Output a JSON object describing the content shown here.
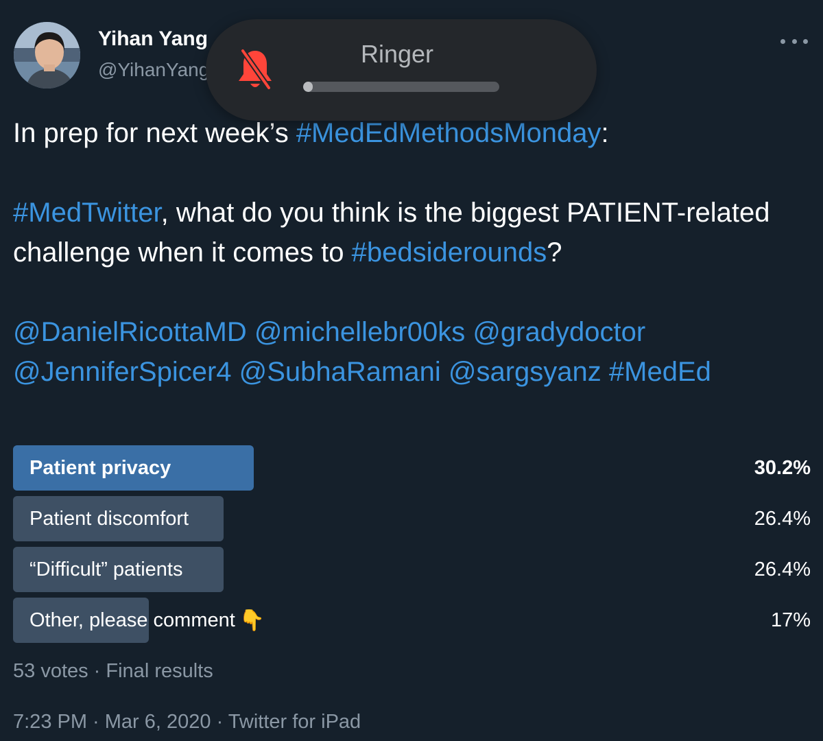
{
  "author": {
    "display_name": "Yihan Yang",
    "handle": "@YihanYang"
  },
  "overlay": {
    "label": "Ringer",
    "icon": "bell-muted-icon",
    "level": 0.05
  },
  "tweet": {
    "line1_pre": "In prep for next week’s ",
    "line1_tag": "#MedEdMethodsMonday",
    "line1_post": ":",
    "para2_tag1": "#MedTwitter",
    "para2_text": ", what do you think is the biggest PATIENT-related challenge when it comes to ",
    "para2_tag2": "#bedsiderounds",
    "para2_post": "?",
    "mentions": "@DanielRicottaMD @michellebr00ks @gradydoctor @JenniferSpicer4 @SubhaRamani @sargsyanz #MedEd"
  },
  "poll": {
    "options": [
      {
        "label": "Patient privacy",
        "percent_text": "30.2%",
        "fraction": 0.302,
        "winner": true
      },
      {
        "label": "Patient discomfort",
        "percent_text": "26.4%",
        "fraction": 0.264,
        "winner": false
      },
      {
        "label": "“Difficult” patients",
        "percent_text": "26.4%",
        "fraction": 0.264,
        "winner": false
      },
      {
        "label": "Other, please comment",
        "emoji": "👇",
        "percent_text": "17%",
        "fraction": 0.17,
        "winner": false
      }
    ],
    "footer": "53 votes · Final results"
  },
  "meta": {
    "timestamp": "7:23 PM · Mar 6, 2020 · Twitter for iPad"
  },
  "colors": {
    "background": "#15202b",
    "link": "#3b94e0",
    "winner_bar": "#3a6fa6",
    "bar": "#3e5064",
    "muted_text": "#8b98a5",
    "ringer_icon": "#ff453a"
  }
}
